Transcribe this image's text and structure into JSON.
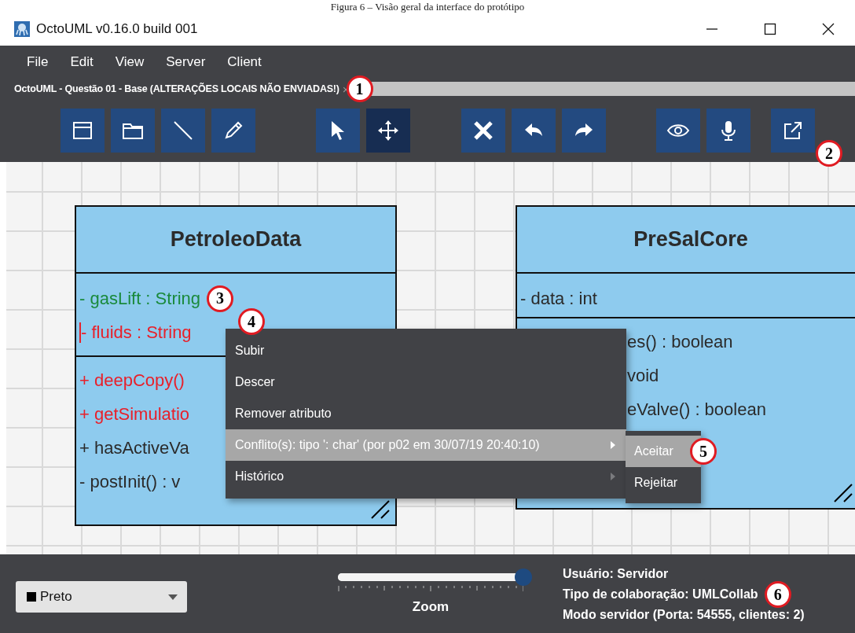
{
  "caption": "Figura 6 – Visão geral da interface do protótipo",
  "window": {
    "title": "OctoUML v0.16.0 build 001"
  },
  "menu_bar": [
    "File",
    "Edit",
    "View",
    "Server",
    "Client"
  ],
  "tab": {
    "label": "OctoUML - Questão 01 - Base (ALTERAÇÕES LOCAIS NÃO ENVIADAS!)",
    "close": "×",
    "callout": "1"
  },
  "toolbar": [
    [
      {
        "kind": "class",
        "selected": false
      },
      {
        "kind": "package",
        "selected": false
      },
      {
        "kind": "edge",
        "selected": false
      },
      {
        "kind": "draw",
        "selected": false
      }
    ],
    [
      {
        "kind": "select",
        "selected": false
      },
      {
        "kind": "move",
        "selected": true
      }
    ],
    [
      {
        "kind": "delete",
        "selected": false
      },
      {
        "kind": "undo",
        "selected": false
      },
      {
        "kind": "redo",
        "selected": false
      }
    ],
    [
      {
        "kind": "eye",
        "selected": false
      },
      {
        "kind": "mic",
        "selected": false
      }
    ],
    [
      {
        "kind": "export",
        "selected": false,
        "callout": "2"
      }
    ]
  ],
  "classes": [
    {
      "name": "PetroleoData",
      "attributes": [
        {
          "text": "- gasLift : String",
          "color": "#1a8a3c",
          "conflict": false,
          "callout": "3"
        },
        {
          "text": "- fluids : String",
          "color": "#e8202a",
          "conflict": true
        }
      ],
      "methods": [
        {
          "text": "+ deepCopy()",
          "color": "#e8202a"
        },
        {
          "text": "+ getSimulatio",
          "color": "#e8202a"
        },
        {
          "text": "+ hasActiveVa",
          "color": "#2b2b2b"
        },
        {
          "text": "- postInit() : v",
          "color": "#2b2b2b"
        }
      ]
    },
    {
      "name": "PreSalCore",
      "attributes": [
        {
          "text": "- data : int",
          "color": "#2b2b2b",
          "conflict": false
        }
      ],
      "methods": [
        {
          "text": "es() : boolean",
          "color": "#2b2b2b"
        },
        {
          "text": "void",
          "color": "#2b2b2b"
        },
        {
          "text": "eValve() : boolean",
          "color": "#2b2b2b"
        }
      ]
    }
  ],
  "context_menu": {
    "callout": "4",
    "items": [
      {
        "label": "Subir",
        "selected": false,
        "submenu": false
      },
      {
        "label": "Descer",
        "selected": false,
        "submenu": false
      },
      {
        "label": "Remover atributo",
        "selected": false,
        "submenu": false
      },
      {
        "label": "Conflito(s): tipo ': char' (por p02 em 30/07/19 20:40:10)",
        "selected": true,
        "submenu": true
      },
      {
        "label": "Histórico",
        "selected": false,
        "submenu": true
      }
    ],
    "submenu": [
      {
        "label": "Aceitar",
        "selected": true,
        "callout": "5"
      },
      {
        "label": "Rejeitar",
        "selected": false
      }
    ]
  },
  "bottom_bar": {
    "color_picker": {
      "value": "Preto"
    },
    "zoom": {
      "level": 1,
      "label": "Zoom"
    },
    "status": [
      {
        "text": "Usuário: Servidor"
      },
      {
        "text": "Tipo de colaboração: UMLCollab",
        "callout": "6"
      },
      {
        "text": "Modo servidor (Porta: 54555, clientes: 2)"
      }
    ]
  }
}
